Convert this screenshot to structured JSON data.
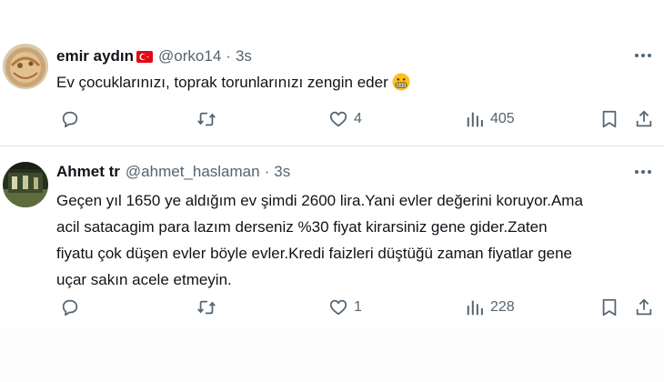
{
  "tweets": [
    {
      "name": "emir aydın",
      "handle": "@orko14",
      "dot": "·",
      "time": "3s",
      "text_lines": [
        "Ev çocuklarınızı, toprak torunlarınızı zengin eder"
      ],
      "emoji": "grimacing-face",
      "flag": "turkey-flag",
      "likes": "4",
      "views": "405"
    },
    {
      "name": "Ahmet tr",
      "handle": "@ahmet_haslaman",
      "dot": "·",
      "time": "3s",
      "text_lines": [
        "Geçen yıl 1650 ye aldığım ev şimdi 2600 lira.Yani evler değerini koruyor.Ama",
        "acil satacagim para lazım derseniz %30 fiyat kirarsiniz gene gider.Zaten",
        "fiyatu çok düşen evler böyle evler.Kredi faizleri düştüğü zaman fiyatlar gene",
        "uçar sakın acele etmeyin."
      ],
      "likes": "1",
      "views": "228"
    }
  ],
  "colors": {
    "text": "#0f1419",
    "secondary": "#536471",
    "divider": "#e1e6ea",
    "flag_red": "#e30a17"
  }
}
